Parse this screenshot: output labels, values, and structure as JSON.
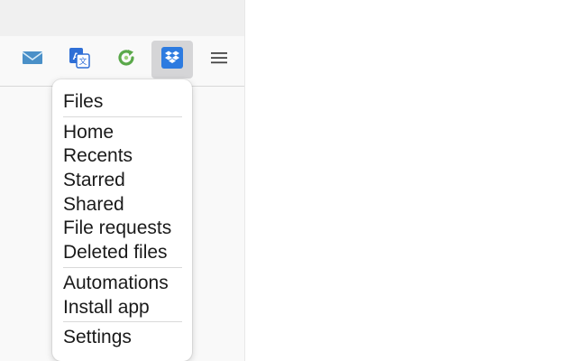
{
  "toolbar": {
    "buttons": [
      {
        "icon": "mail-icon"
      },
      {
        "icon": "translate-icon"
      },
      {
        "icon": "refresh-icon"
      },
      {
        "icon": "dropbox-icon",
        "active": true
      },
      {
        "icon": "hamburger-menu-icon"
      }
    ]
  },
  "menu": {
    "header": "Files",
    "items": [
      "Home",
      "Recents",
      "Starred",
      "Shared",
      "File requests",
      "Deleted files"
    ],
    "items2": [
      "Automations",
      "Install app"
    ],
    "footer": "Settings"
  },
  "colors": {
    "dropbox_blue": "#0061fe",
    "mail_blue": "#4a90c8",
    "refresh_green": "#5aa84a"
  }
}
